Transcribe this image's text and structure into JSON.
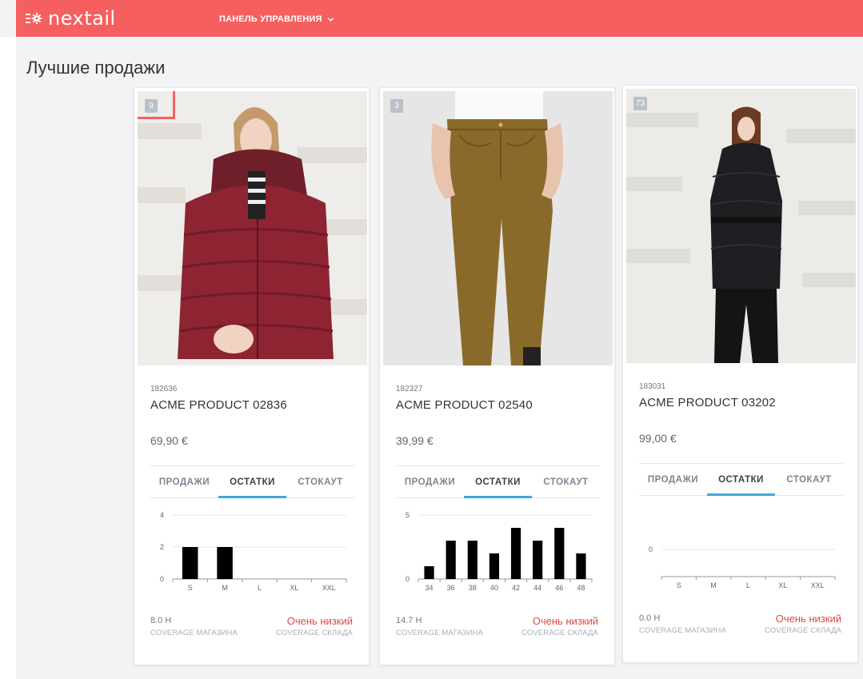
{
  "app": {
    "brand": "nextail",
    "nav_menu_label": "ПАНЕЛЬ УПРАВЛЕНИЯ",
    "accent": "#f55f5f",
    "tab_active_color": "#3fa9d8"
  },
  "page": {
    "title": "Лучшие продажи"
  },
  "products": [
    {
      "rank": "9",
      "sku": "182636",
      "name": "ACME PRODUCT 02836",
      "price": "69,90 €",
      "tabs": [
        "ПРОДАЖИ",
        "ОСТАТКИ",
        "СТОКАУТ"
      ],
      "active_tab": "ОСТАТКИ",
      "store_coverage": "8.0 Н",
      "store_coverage_label": "COVERAGE МАГАЗИНА",
      "warehouse_coverage": "Очень низкий",
      "warehouse_coverage_label": "COVERAGE СКЛАДА",
      "photo": "woman in burgundy puffer jacket"
    },
    {
      "rank": "3",
      "sku": "182327",
      "name": "ACME PRODUCT 02540",
      "price": "39,99 €",
      "tabs": [
        "ПРОДАЖИ",
        "ОСТАТКИ",
        "СТОКАУТ"
      ],
      "active_tab": "ОСТАТКИ",
      "store_coverage": "14.7 Н",
      "store_coverage_label": "COVERAGE МАГАЗИНА",
      "warehouse_coverage": "Очень низкий",
      "warehouse_coverage_label": "COVERAGE СКЛАДА",
      "photo": "olive brown slim trousers"
    },
    {
      "rank": "73",
      "sku": "183031",
      "name": "ACME PRODUCT 03202",
      "price": "99,00 €",
      "tabs": [
        "ПРОДАЖИ",
        "ОСТАТКИ",
        "СТОКАУТ"
      ],
      "active_tab": "ОСТАТКИ",
      "store_coverage": "0.0 Н",
      "store_coverage_label": "COVERAGE МАГАЗИНА",
      "warehouse_coverage": "Очень низкий",
      "warehouse_coverage_label": "COVERAGE СКЛАДА",
      "photo": "woman in black belted down coat"
    }
  ],
  "chart_data": [
    {
      "type": "bar",
      "categories": [
        "S",
        "M",
        "L",
        "XL",
        "XXL"
      ],
      "values": [
        2,
        2,
        0,
        0,
        0
      ],
      "yticks": [
        0,
        2,
        4
      ],
      "ylim": [
        0,
        4
      ],
      "bar_color": "#000000"
    },
    {
      "type": "bar",
      "categories": [
        "34",
        "36",
        "38",
        "40",
        "42",
        "44",
        "46",
        "48"
      ],
      "values": [
        1,
        3,
        3,
        2,
        4,
        3,
        4,
        2
      ],
      "yticks": [
        0,
        5
      ],
      "ylim": [
        0,
        5
      ],
      "bar_color": "#000000"
    },
    {
      "type": "bar",
      "categories": [
        "S",
        "M",
        "L",
        "XL",
        "XXL"
      ],
      "values": [
        0,
        0,
        0,
        0,
        0
      ],
      "yticks": [
        0
      ],
      "ylim": [
        0,
        1
      ],
      "bar_color": "#000000"
    }
  ]
}
